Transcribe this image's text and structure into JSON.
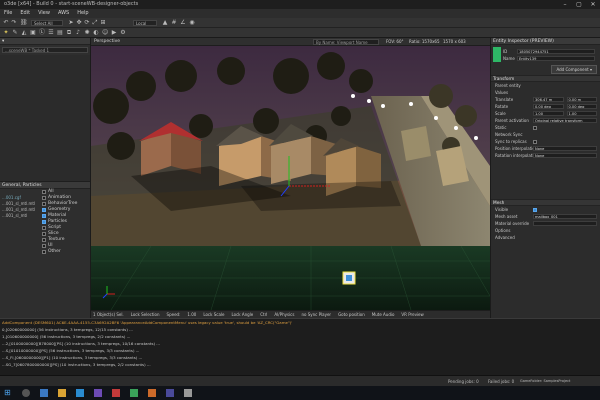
{
  "window": {
    "title": "o3de [x64] - Build 0 - start-sceneWB-designer-objects",
    "controls": [
      "–",
      "▢",
      "✕"
    ]
  },
  "menu": [
    "File",
    "Edit",
    "View",
    "AWS",
    "Help"
  ],
  "toolbar": {
    "level_select": "Select All",
    "space_select": "Local"
  },
  "left_panel": {
    "search_placeholder": "...sceneWB * Tasked 1",
    "filter_header": "General, Particles",
    "filters": [
      {
        "label": "All",
        "on": false
      },
      {
        "label": "Animation",
        "on": false
      },
      {
        "label": "BehaviorTree",
        "on": false
      },
      {
        "label": "Geometry",
        "on": true
      },
      {
        "label": "Material",
        "on": true
      },
      {
        "label": "Particles",
        "on": true
      },
      {
        "label": "Script",
        "on": false
      },
      {
        "label": "Slice",
        "on": false
      },
      {
        "label": "Texture",
        "on": false
      },
      {
        "label": "UI",
        "on": false
      },
      {
        "label": "Other",
        "on": false
      }
    ],
    "assets": [
      "...001.cgf",
      "...001_sl_mtl.mtl",
      "...001_sl_mtl.mtl",
      "...001_sl_mtl"
    ]
  },
  "viewport": {
    "tab": "Perspective",
    "search": "By Name: Viewport Name",
    "fov": "FOV: 60°",
    "ratio": "Ratio: 1570x65",
    "res": "1570 x 603",
    "status": [
      "1 Object(s) Sel.",
      "Lock Selection",
      "Speed:",
      "1.00",
      "Lock Scale",
      "Lock Angle",
      "Ctrl",
      "AI/Physics",
      "no Sync Player",
      "Goto position",
      "Mute Audio",
      "VR Preview"
    ]
  },
  "inspector": {
    "header": "Entity Inspector (PREVIEW)",
    "entity_id_label": "ID",
    "entity_id": "1805072944751",
    "name_label": "Name",
    "entity_name": "Entity139",
    "add_component": "Add Component ▾",
    "transform_header": "Transform",
    "parent_entity": "Parent entity",
    "values_header": "Values",
    "translate_label": "Translate",
    "translate": [
      "306.47 m",
      "0.00 m",
      "0.00 m"
    ],
    "rotate_label": "Rotate",
    "rotate": [
      "0.00 deg",
      "0.00 deg",
      "0.00 deg"
    ],
    "scale_label": "Scale",
    "scale": [
      "1.00",
      "1.00",
      "1.00"
    ],
    "parent_activation_label": "Parent activation",
    "parent_activation": "Original relative transform",
    "static_label": "Static",
    "network_sync_label": "Network Sync",
    "sync_replicas_label": "Sync to replicas",
    "position_interp_label": "Position interpolation",
    "position_interp": "None",
    "rotation_interp_label": "Rotation interpolation",
    "rotation_interp": "None",
    "mesh_header": "Mesh",
    "visible_label": "Visible",
    "mesh_asset_label": "Mesh asset",
    "mesh_asset": "mailbox_001",
    "material_override_label": "Material override",
    "options_label": "Options",
    "advanced_label": "Advanced"
  },
  "console": {
    "lines": [
      {
        "text": "AddComponent (DESM601) AC6E-4AAA-4155-C3A692A2BF6 'AppearanceAddComponentMenu' uses legacy value 'true', should be 'AZ_CRC(\"Game\")'",
        "warn": true
      },
      {
        "text": "0,[02060000000] (56 instructions, 3 tempregs, 12/15 constants) ...",
        "warn": false
      },
      {
        "text": "1,[010600000000] (56 instructions, 3 tempregs, 2/2 constants) ...",
        "warn": false
      },
      {
        "text": "...2,[0100000000][B78000][PS] (10 instructions, 3 tempregs, 10/16 constants) ...",
        "warn": false
      },
      {
        "text": "...S,[01010000000][PS] (56 instructions, 3 tempregs, 3/3 constants) ...",
        "warn": false
      },
      {
        "text": "...S_FI,[0600000000][P1] (10 instructions, 3 tempregs, 3/3 constants) ...",
        "warn": false
      },
      {
        "text": "...SG_7[0607800000000][PS] (10 instructions, 3 tempregs, 2/2 constants) ...",
        "warn": false
      }
    ]
  },
  "app_status": {
    "pending": "Pending jobs: 0",
    "failed": "Failed jobs: 0",
    "project": "GameFolder: SamplesProject",
    "game": "GameFolder..."
  },
  "colors": {
    "accent": "#3d8fd8",
    "ground": "#1b3a24",
    "sky": "#3a2b3f"
  }
}
